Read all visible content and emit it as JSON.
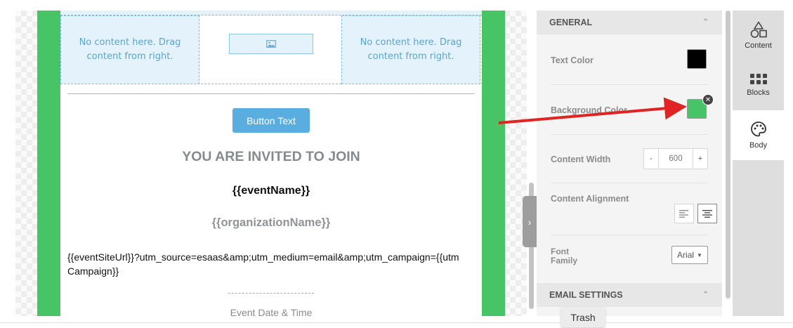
{
  "email": {
    "drop_left": "No content here. Drag content from right.",
    "drop_right": "No content here. Drag content from right.",
    "button_text": "Button Text",
    "invite_heading": "YOU ARE INVITED TO JOIN",
    "event_name": "{{eventName}}",
    "organization_name": "{{organizationName}}",
    "event_url": "{{eventSiteUrl}}?utm_source=esaas&amp;utm_medium=email&amp;utm_campaign={{utmCampaign}}",
    "event_date_label": "Event Date & Time",
    "background_color": "#47c566"
  },
  "panel": {
    "general_title": "GENERAL",
    "text_color_label": "Text Color",
    "text_color_value": "#000000",
    "background_color_label": "Background Color",
    "background_color_value": "#47c566",
    "content_width_label": "Content Width",
    "content_width_minus": "-",
    "content_width_value": "600",
    "content_width_plus": "+",
    "content_alignment_label": "Content Alignment",
    "content_alignment_selected": "center",
    "font_family_label_1": "Font",
    "font_family_label_2": "Family",
    "font_family_value": "Arial",
    "email_settings_title": "EMAIL SETTINGS"
  },
  "tabs": [
    {
      "label": "Content",
      "icon": "shapes-icon"
    },
    {
      "label": "Blocks",
      "icon": "grid-icon"
    },
    {
      "label": "Body",
      "icon": "palette-icon",
      "active": true
    }
  ],
  "trash_label": "Trash",
  "annotation": {
    "arrow_color": "#e02424"
  }
}
